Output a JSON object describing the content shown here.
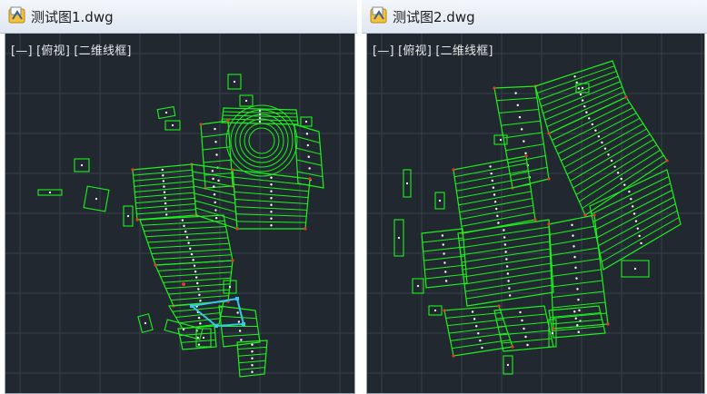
{
  "panes": [
    {
      "title": "测试图1.dwg",
      "viewport_label": "[—] [俯视] [二维线框]"
    },
    {
      "title": "测试图2.dwg",
      "viewport_label": "[—] [俯视] [二维线框]"
    }
  ],
  "icon": "autocad-drawing-file-icon",
  "colors": {
    "viewport_bg": "#212830",
    "grid": "#36404b",
    "parcel_line": "#1df21d",
    "red_marks": "#e03a2a",
    "selected_parcel": "#3ac8e8",
    "point_marks": "#ffffff"
  }
}
